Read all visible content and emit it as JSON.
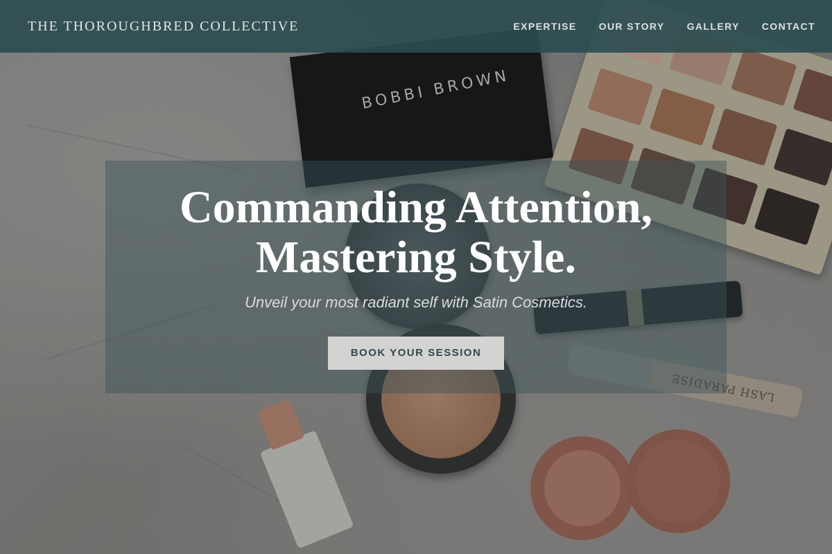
{
  "header": {
    "brand": "THE THOROUGHBRED COLLECTIVE",
    "nav": [
      {
        "label": "EXPERTISE"
      },
      {
        "label": "OUR STORY"
      },
      {
        "label": "GALLERY"
      },
      {
        "label": "CONTACT"
      }
    ]
  },
  "hero": {
    "headline_line1": "Commanding Attention,",
    "headline_line2": "Mastering Style.",
    "subheadline": "Unveil your most radiant self with Satin Cosmetics.",
    "cta_label": "BOOK YOUR SESSION"
  },
  "background_image": {
    "product_texts": {
      "bobbi_brown_box": "BOBBI BROWN",
      "lash_tube": "LASH PARADISE"
    }
  },
  "colors": {
    "header_bg": "#2c4d50",
    "hero_panel": "#3c5558",
    "cta_bg": "#d3d3d2",
    "cta_text": "#30484a"
  }
}
